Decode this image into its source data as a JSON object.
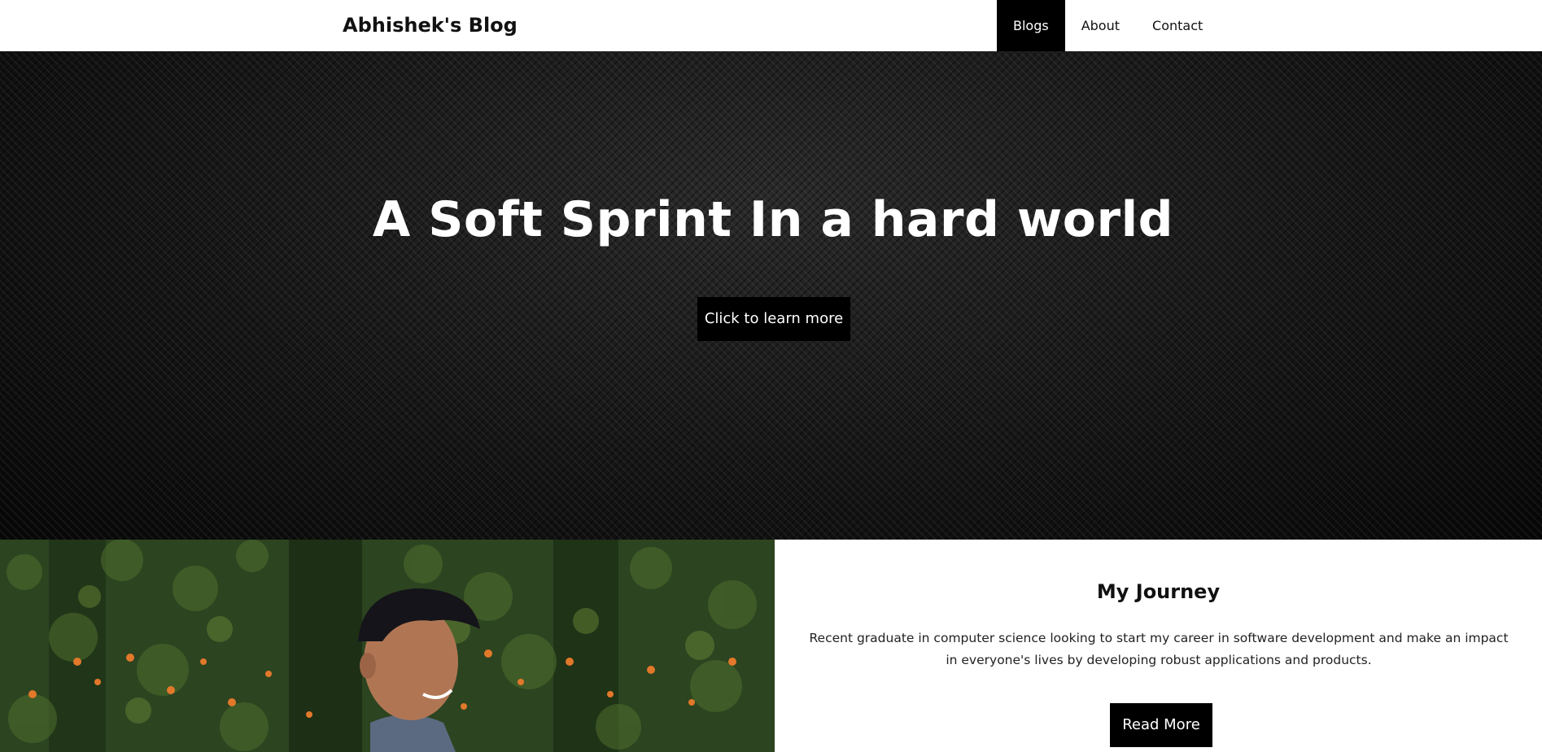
{
  "header": {
    "brand": "Abhishek's Blog",
    "nav": [
      {
        "label": "Blogs",
        "active": true
      },
      {
        "label": "About",
        "active": false
      },
      {
        "label": "Contact",
        "active": false
      }
    ]
  },
  "hero": {
    "title": "A Soft Sprint In a hard world",
    "button_label": "Click to learn more"
  },
  "journey": {
    "title": "My Journey",
    "text": "Recent graduate in computer science looking to start my career in software development and make an impact in everyone's lives by developing robust applications and products.",
    "button_label": "Read More"
  },
  "colors": {
    "nav_active_bg": "#000000",
    "hero_bg": "#141414",
    "button_bg": "#000000",
    "button_text": "#ffffff"
  }
}
